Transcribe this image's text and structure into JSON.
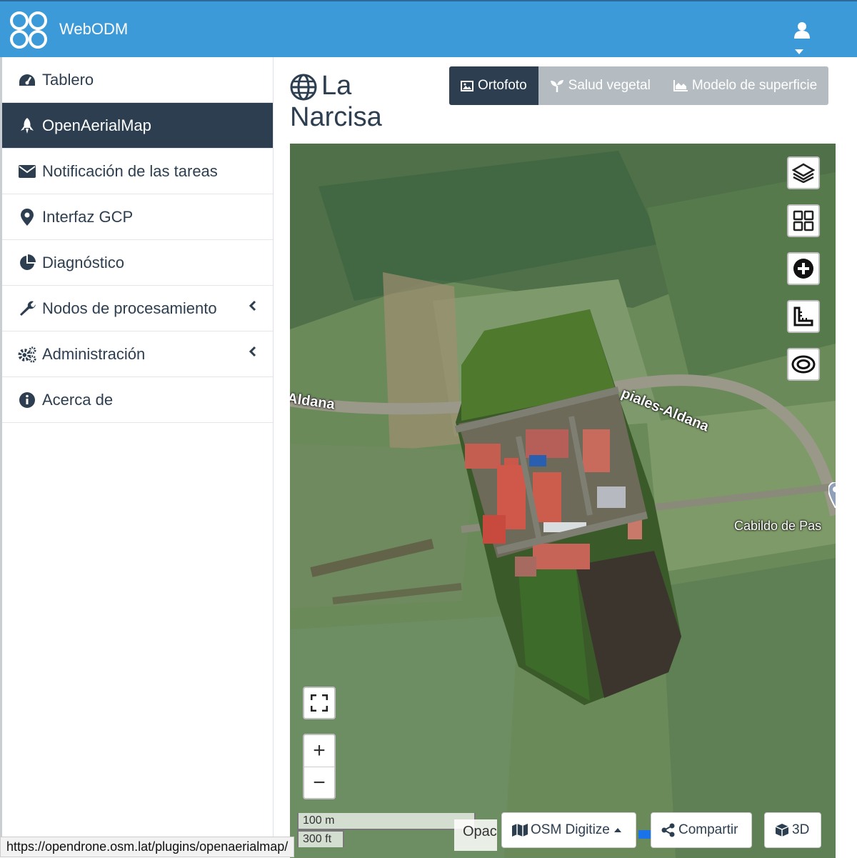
{
  "app": {
    "brand": "WebODM"
  },
  "sidebar": {
    "items": [
      {
        "label": "Tablero",
        "icon": "dashboard-icon"
      },
      {
        "label": "OpenAerialMap",
        "icon": "rocket-icon",
        "active": true
      },
      {
        "label": "Notificación de las tareas",
        "icon": "envelope-icon"
      },
      {
        "label": "Interfaz GCP",
        "icon": "map-marker-icon"
      },
      {
        "label": "Diagnóstico",
        "icon": "pie-chart-icon"
      },
      {
        "label": "Nodos de procesamiento",
        "icon": "wrench-icon",
        "expandable": true
      },
      {
        "label": "Administración",
        "icon": "cogs-icon",
        "expandable": true
      },
      {
        "label": "Acerca de",
        "icon": "info-icon"
      }
    ]
  },
  "page": {
    "title": "La Narcisa",
    "tabs": [
      {
        "label": "Ortofoto",
        "icon": "image-icon",
        "active": true
      },
      {
        "label": "Salud vegetal",
        "icon": "seedling-icon"
      },
      {
        "label": "Modelo de superficie",
        "icon": "area-chart-icon"
      }
    ]
  },
  "map": {
    "labels": {
      "road_left": "Aldana",
      "road_right": "piales-Aldana",
      "place": "Cabildo de Pas"
    },
    "scale": {
      "metric": "100 m",
      "imperial": "300 ft"
    },
    "opacity_label": "Opac",
    "buttons": {
      "osm": "OSM Digitize",
      "share": "Compartir",
      "three_d": "3D"
    },
    "zoom": {
      "in": "+",
      "out": "−"
    }
  },
  "status_url": "https://opendrone.osm.lat/plugins/openaerialmap/",
  "colors": {
    "topbar": "#3d9ad9",
    "sidebar_active": "#2c3e50",
    "tab_inactive": "#b4bcc2"
  }
}
